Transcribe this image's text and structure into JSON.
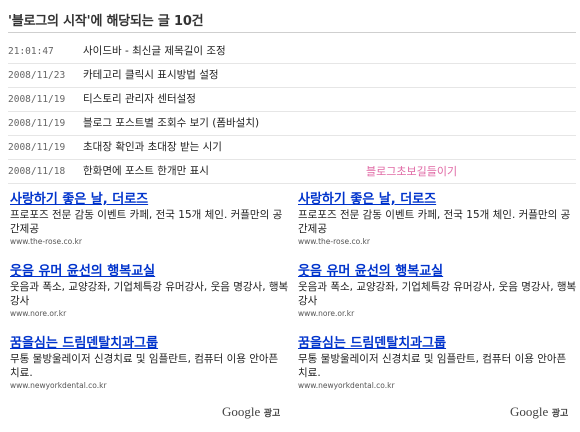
{
  "header": {
    "title": "'블로그의 시작'에 해당되는 글 10건"
  },
  "posts": [
    {
      "date": "21:01:47",
      "title": "사이드바 - 최신글 제목길이 조정"
    },
    {
      "date": "2008/11/23",
      "title": "카테고리 클릭시 표시방법 설정"
    },
    {
      "date": "2008/11/19",
      "title": "티스토리 관리자 센터설정"
    },
    {
      "date": "2008/11/19",
      "title": "블로그 포스트별 조회수 보기 (폼바설치)"
    },
    {
      "date": "2008/11/19",
      "title": "초대장 확인과 초대장 받는 시기"
    },
    {
      "date": "2008/11/18",
      "title": "한화면에 포스트 한개만 표시"
    }
  ],
  "side_link": "블로그초보길들이기",
  "ads_left": [
    {
      "title": "사랑하기 좋은 날, 더로즈",
      "desc": "프로포즈 전문 감동 이벤트 카페, 전국 15개 체인. 커플만의 공간제공",
      "url": "www.the-rose.co.kr"
    },
    {
      "title": "웃음 유머 윤선의 행복교실",
      "desc": "웃음과 폭소, 교양강좌, 기업체특강 유머강사, 웃음 명강사, 행복강사",
      "url": "www.nore.or.kr"
    },
    {
      "title": "꿈을심는 드림덴탈치과그룹",
      "desc": "무통 물방울레이저 신경치료 및 임플란트, 컴퓨터 이용 안아픈 치료.",
      "url": "www.newyorkdental.co.kr"
    }
  ],
  "ads_right": [
    {
      "title": "사랑하기 좋은 날, 더로즈",
      "desc": "프로포즈 전문 감동 이벤트 카페, 전국 15개 체인. 커플만의 공간제공",
      "url": "www.the-rose.co.kr"
    },
    {
      "title": "웃음 유머 윤선의 행복교실",
      "desc": "웃음과 폭소, 교양강좌, 기업체특강 유머강사, 웃음 명강사, 행복강사",
      "url": "www.nore.or.kr"
    },
    {
      "title": "꿈을심는 드림덴탈치과그룹",
      "desc": "무통 물방울레이저 신경치료 및 임플란트, 컴퓨터 이용 안아픈 치료.",
      "url": "www.newyorkdental.co.kr"
    }
  ],
  "google_ads": {
    "brand": "Google",
    "suffix": "광고"
  },
  "colors": {
    "ad_title": "#0033cc",
    "side_link": "#e06aa5"
  }
}
